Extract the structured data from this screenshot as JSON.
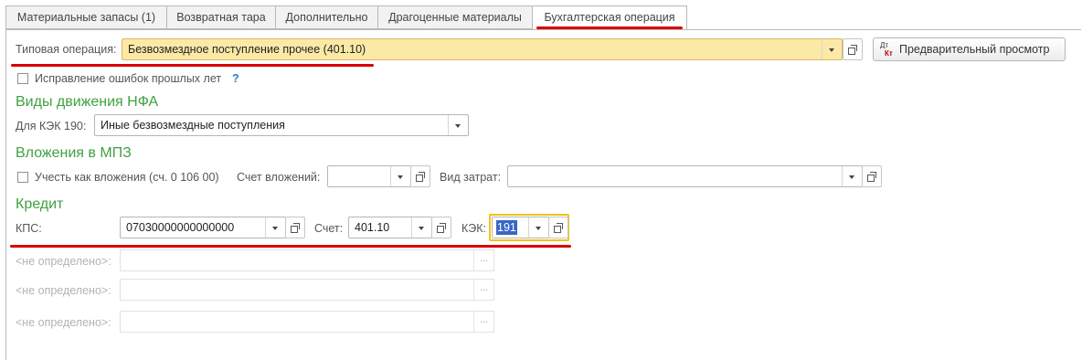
{
  "tabs": [
    {
      "label": "Материальные запасы (1)"
    },
    {
      "label": "Возвратная тара"
    },
    {
      "label": "Дополнительно"
    },
    {
      "label": "Драгоценные материалы"
    },
    {
      "label": "Бухгалтерская операция"
    }
  ],
  "typical_operation": {
    "label": "Типовая операция:",
    "value": "Безвозмездное поступление прочее (401.10)",
    "highlight_color": "#fde9a6"
  },
  "preview_button": {
    "label": "Предварительный просмотр",
    "icon": "dt-kt-icon",
    "icon_top": "Дт",
    "icon_bottom": "Кт"
  },
  "fix_errors": {
    "label": "Исправление ошибок прошлых лет",
    "help": "?"
  },
  "nfa_section": {
    "title": "Виды движения НФА",
    "kek_label": "Для КЭК 190:",
    "kek_value": "Иные безвозмездные поступления"
  },
  "mpz_section": {
    "title": "Вложения в МПЗ",
    "checkbox_label": "Учесть как вложения (сч. 0 106 00)",
    "account_label": "Счет вложений:",
    "account_value": "",
    "cost_label": "Вид затрат:",
    "cost_value": ""
  },
  "credit_section": {
    "title": "Кредит",
    "kps_label": "КПС:",
    "kps_value": "07030000000000000",
    "account_label": "Счет:",
    "account_value": "401.10",
    "kek_label": "КЭК:",
    "kek_value": "191"
  },
  "undefined_rows": [
    {
      "label": "<не определено>:"
    },
    {
      "label": "<не определено>:"
    },
    {
      "label": "<не определено>:"
    }
  ],
  "colors": {
    "accent_green": "#3fa142",
    "annotation_red": "#d90000",
    "focus_yellow": "#f0c419"
  }
}
